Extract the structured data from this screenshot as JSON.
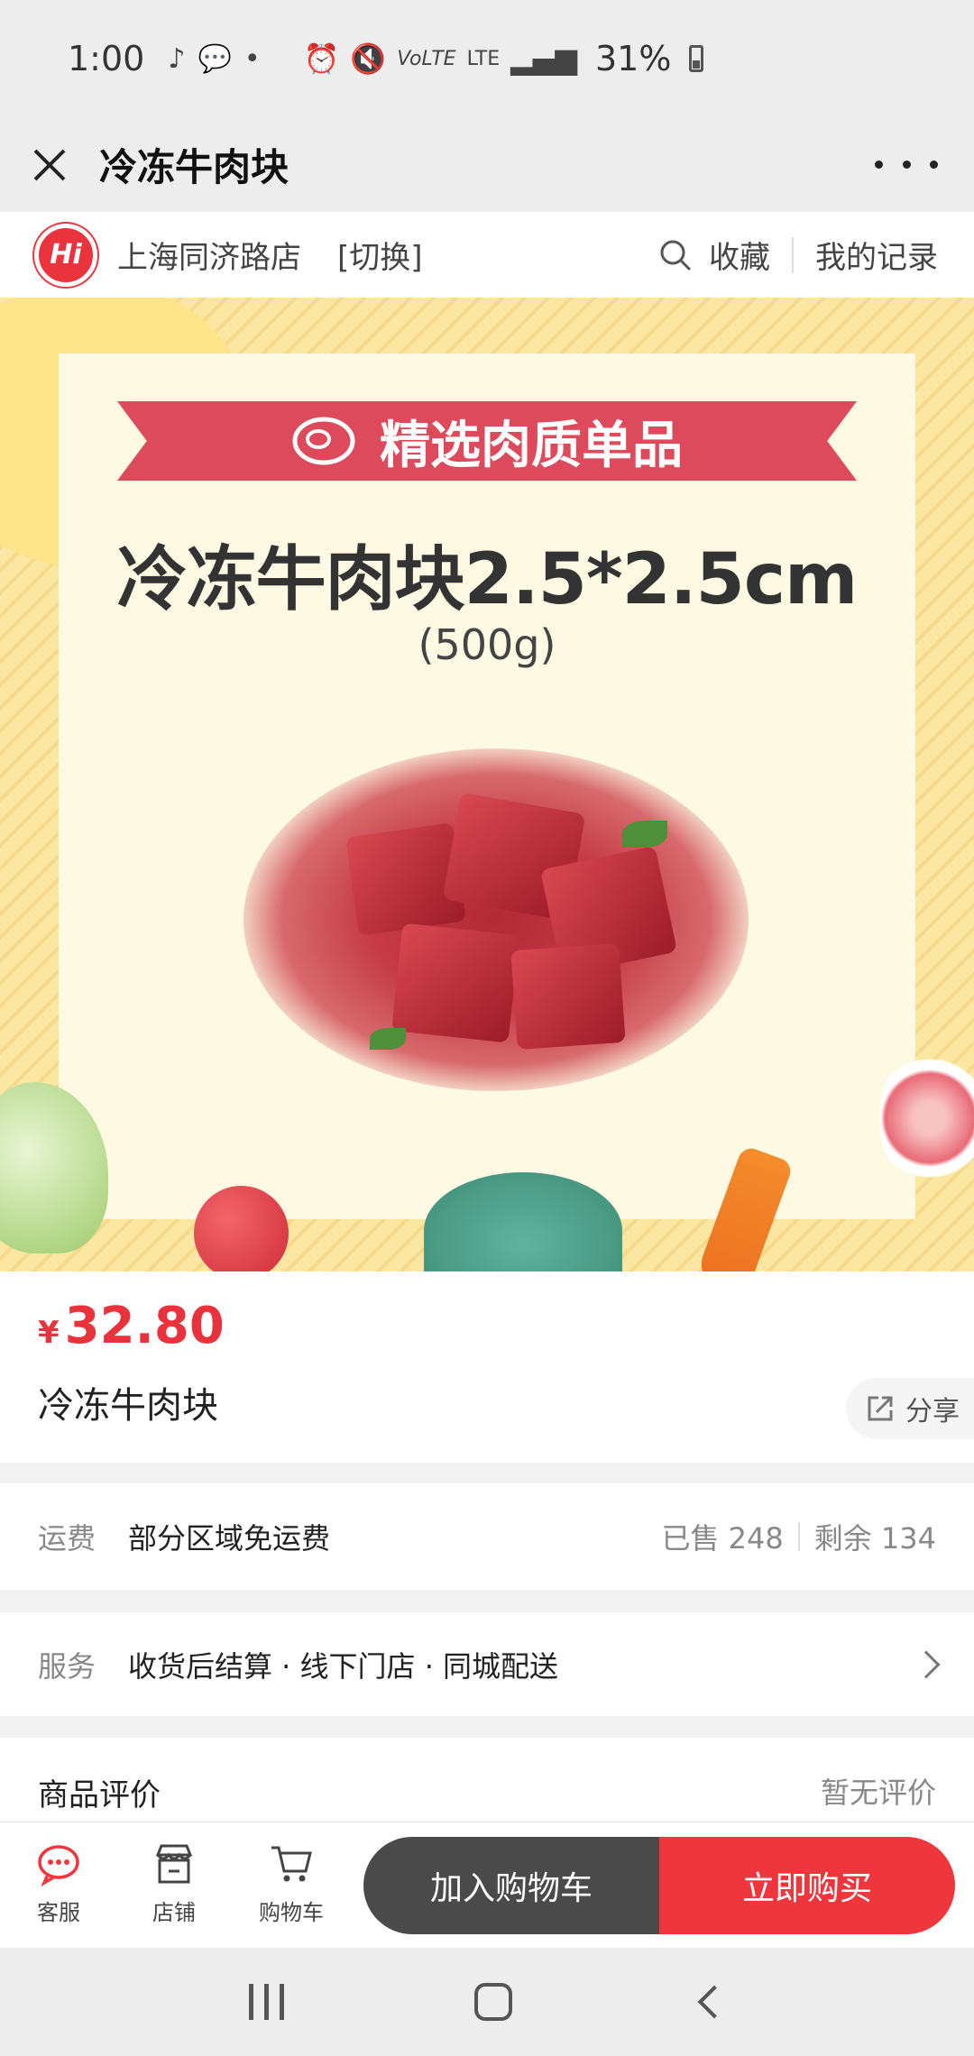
{
  "status_bar": {
    "time": "1:00",
    "notification_icons": [
      "tiktok-icon",
      "talk-icon",
      "dot-icon"
    ],
    "network_label": "LTE",
    "volte_label": "VoLTE",
    "battery_percent": "31%"
  },
  "title_bar": {
    "title": "冷冻牛肉块"
  },
  "store_bar": {
    "logo_text": "Hi",
    "store_name": "上海同济路店",
    "switch_label": "[切换]",
    "favorite_label": "收藏",
    "records_label": "我的记录"
  },
  "hero": {
    "banner_text": "精选肉质单品",
    "title": "冷冻牛肉块2.5*2.5cm",
    "subtitle": "(500g)"
  },
  "product": {
    "currency": "¥",
    "price": "32.80",
    "name": "冷冻牛肉块",
    "share_label": "分享"
  },
  "shipping": {
    "label": "运费",
    "value": "部分区域免运费",
    "sold": "已售 248",
    "remaining": "剩余 134"
  },
  "service": {
    "label": "服务",
    "value": "收货后结算 · 线下门店 · 同城配送"
  },
  "reviews": {
    "title": "商品评价",
    "status": "暂无评价"
  },
  "action_bar": {
    "service_label": "客服",
    "store_label": "店铺",
    "cart_label": "购物车",
    "add_to_cart": "加入购物车",
    "buy_now": "立即购买"
  },
  "colors": {
    "accent_red": "#f0363d",
    "price_red": "#e8333d",
    "dark_button": "#4a4a4a",
    "banner_pink": "#dc4a5c"
  }
}
